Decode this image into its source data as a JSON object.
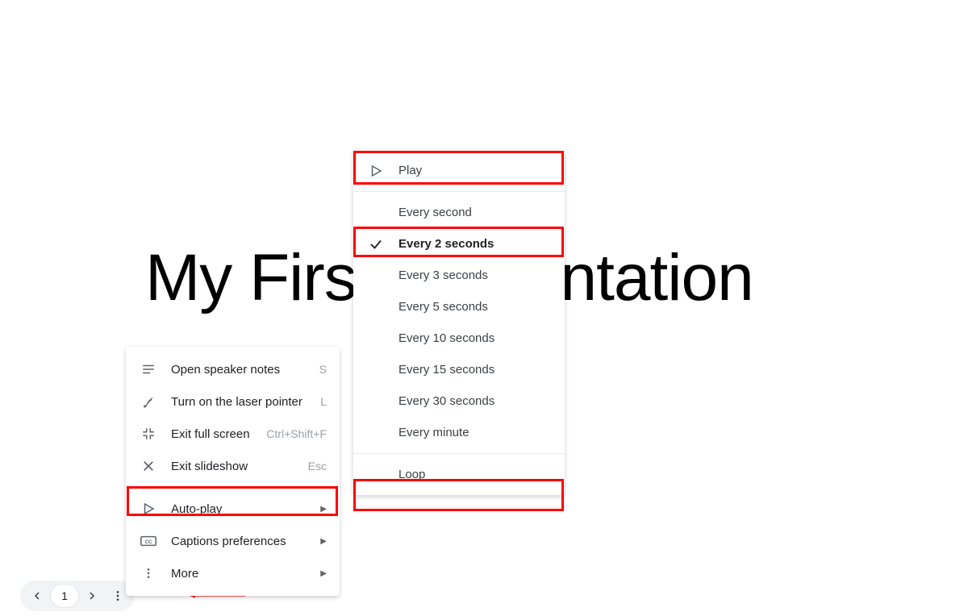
{
  "slide": {
    "title": "My First Presentation"
  },
  "nav": {
    "page": "1"
  },
  "menu": {
    "open_notes": "Open speaker notes",
    "open_notes_key": "S",
    "laser": "Turn on the laser pointer",
    "laser_key": "L",
    "exit_full": "Exit full screen",
    "exit_full_key": "Ctrl+Shift+F",
    "exit_show": "Exit slideshow",
    "exit_show_key": "Esc",
    "autoplay": "Auto-play",
    "captions": "Captions preferences",
    "more": "More"
  },
  "autoplay": {
    "play": "Play",
    "options": [
      "Every second",
      "Every 2 seconds",
      "Every 3 seconds",
      "Every 5 seconds",
      "Every 10 seconds",
      "Every 15 seconds",
      "Every 30 seconds",
      "Every minute"
    ],
    "selected_index": 1,
    "loop": "Loop"
  }
}
